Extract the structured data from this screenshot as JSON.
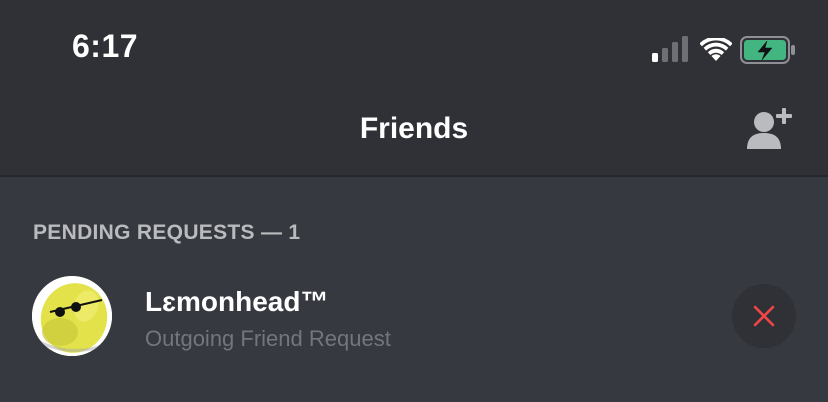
{
  "status_bar": {
    "time": "6:17",
    "icons": [
      "signal-icon",
      "wifi-icon",
      "battery-charging-icon"
    ]
  },
  "header": {
    "title": "Friends",
    "action_icon": "add-friend-icon"
  },
  "pending": {
    "section_label": "PENDING REQUESTS — 1",
    "requests": [
      {
        "username": "Lɛmonhead™",
        "subtext": "Outgoing Friend Request",
        "action_icon": "close-icon"
      }
    ]
  },
  "colors": {
    "background": "#36393f",
    "header_background": "#303136",
    "section_label": "#b9bbbe",
    "subtext": "#72767d",
    "cancel_icon": "#f04747",
    "battery_green": "#43b581"
  }
}
